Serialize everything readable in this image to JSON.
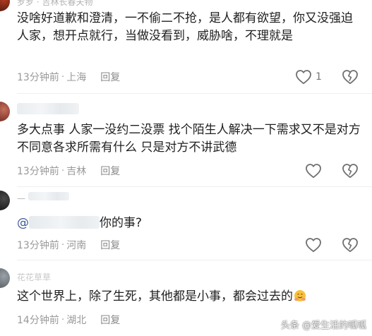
{
  "comments": [
    {
      "username": "罗罗 · 吉林长春夫物",
      "text": "没啥好道歉和澄清，一不偷二不抢，是人都有欲望，你又没强迫人家，想开点就行，当做没看到，威胁啥，不理就是",
      "time": "13分钟前",
      "location": "上海",
      "reply_label": "回复",
      "like_count": "1"
    },
    {
      "username": "",
      "text": "多大点事 人家一没约二没票 找个陌生人解决一下需求又不是对方不同意各求所需有什么 只是对方不讲武德",
      "time": "13分钟前",
      "location": "吉林",
      "reply_label": "回复",
      "like_count": ""
    },
    {
      "username": "—",
      "mention_prefix": "@",
      "text": "你的事?",
      "time": "13分钟前",
      "location": "河南",
      "reply_label": "回复",
      "like_count": ""
    },
    {
      "username": "花花草草",
      "text": "这个世界上，除了生死，其他都是小事，都会过去的",
      "time": "14分钟前",
      "location": "湖北",
      "reply_label": "回复",
      "like_count": ""
    }
  ],
  "separator": "·",
  "icons": {
    "like": "heart-outline-icon",
    "dislike": "broken-heart-icon",
    "emoji": "hugging-face-emoji"
  },
  "colors": {
    "text": "#1f1f1f",
    "meta": "#999999",
    "icon": "#777777"
  },
  "watermark": "头条 @爱生活的呱呱"
}
